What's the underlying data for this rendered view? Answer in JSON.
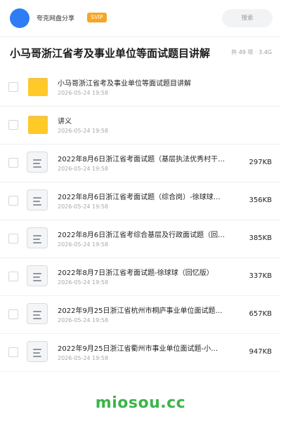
{
  "header": {
    "brand_name": "夸克网盘分享",
    "badge": "SVIP",
    "search_placeholder": "搜索",
    "avatar_color": "#2e7cf6",
    "badge_color": "#f5a623"
  },
  "title_row": {
    "title": "小马哥浙江省考及事业单位等面试题目讲解",
    "meta": "共 49 项 · 3.4G"
  },
  "files": [
    {
      "type": "folder",
      "name": "小马哥浙江省考及事业单位等面试题目讲解",
      "date": "2026-05-24 19:58",
      "size": ""
    },
    {
      "type": "folder",
      "name": "讲义",
      "date": "2026-05-24 19:58",
      "size": ""
    },
    {
      "type": "doc",
      "name": "2022年8月6日浙江省考面试题（基层执法优秀村干…",
      "date": "2026-05-24 19:58",
      "size": "297KB"
    },
    {
      "type": "doc",
      "name": "2022年8月6日浙江省考面试题（综合岗）-徐球球…",
      "date": "2026-05-24 19:58",
      "size": "356KB"
    },
    {
      "type": "doc",
      "name": "2022年8月6日浙江省考综合基层及行政面试题（回…",
      "date": "2026-05-24 19:58",
      "size": "385KB"
    },
    {
      "type": "doc",
      "name": "2022年8月7日浙江省考面试题-徐球球（回忆版）",
      "date": "2026-05-24 19:58",
      "size": "337KB"
    },
    {
      "type": "doc",
      "name": "2022年9月25日浙江省杭州市桐庐事业单位面试题…",
      "date": "2026-05-24 19:58",
      "size": "657KB"
    },
    {
      "type": "doc",
      "name": "2022年9月25日浙江省衢州市事业单位面试题-小…",
      "date": "2026-05-24 19:58",
      "size": "947KB"
    }
  ],
  "watermark": "miosou.cc",
  "colors": {
    "folder": "#ffc928",
    "watermark": "#3cb44a"
  }
}
